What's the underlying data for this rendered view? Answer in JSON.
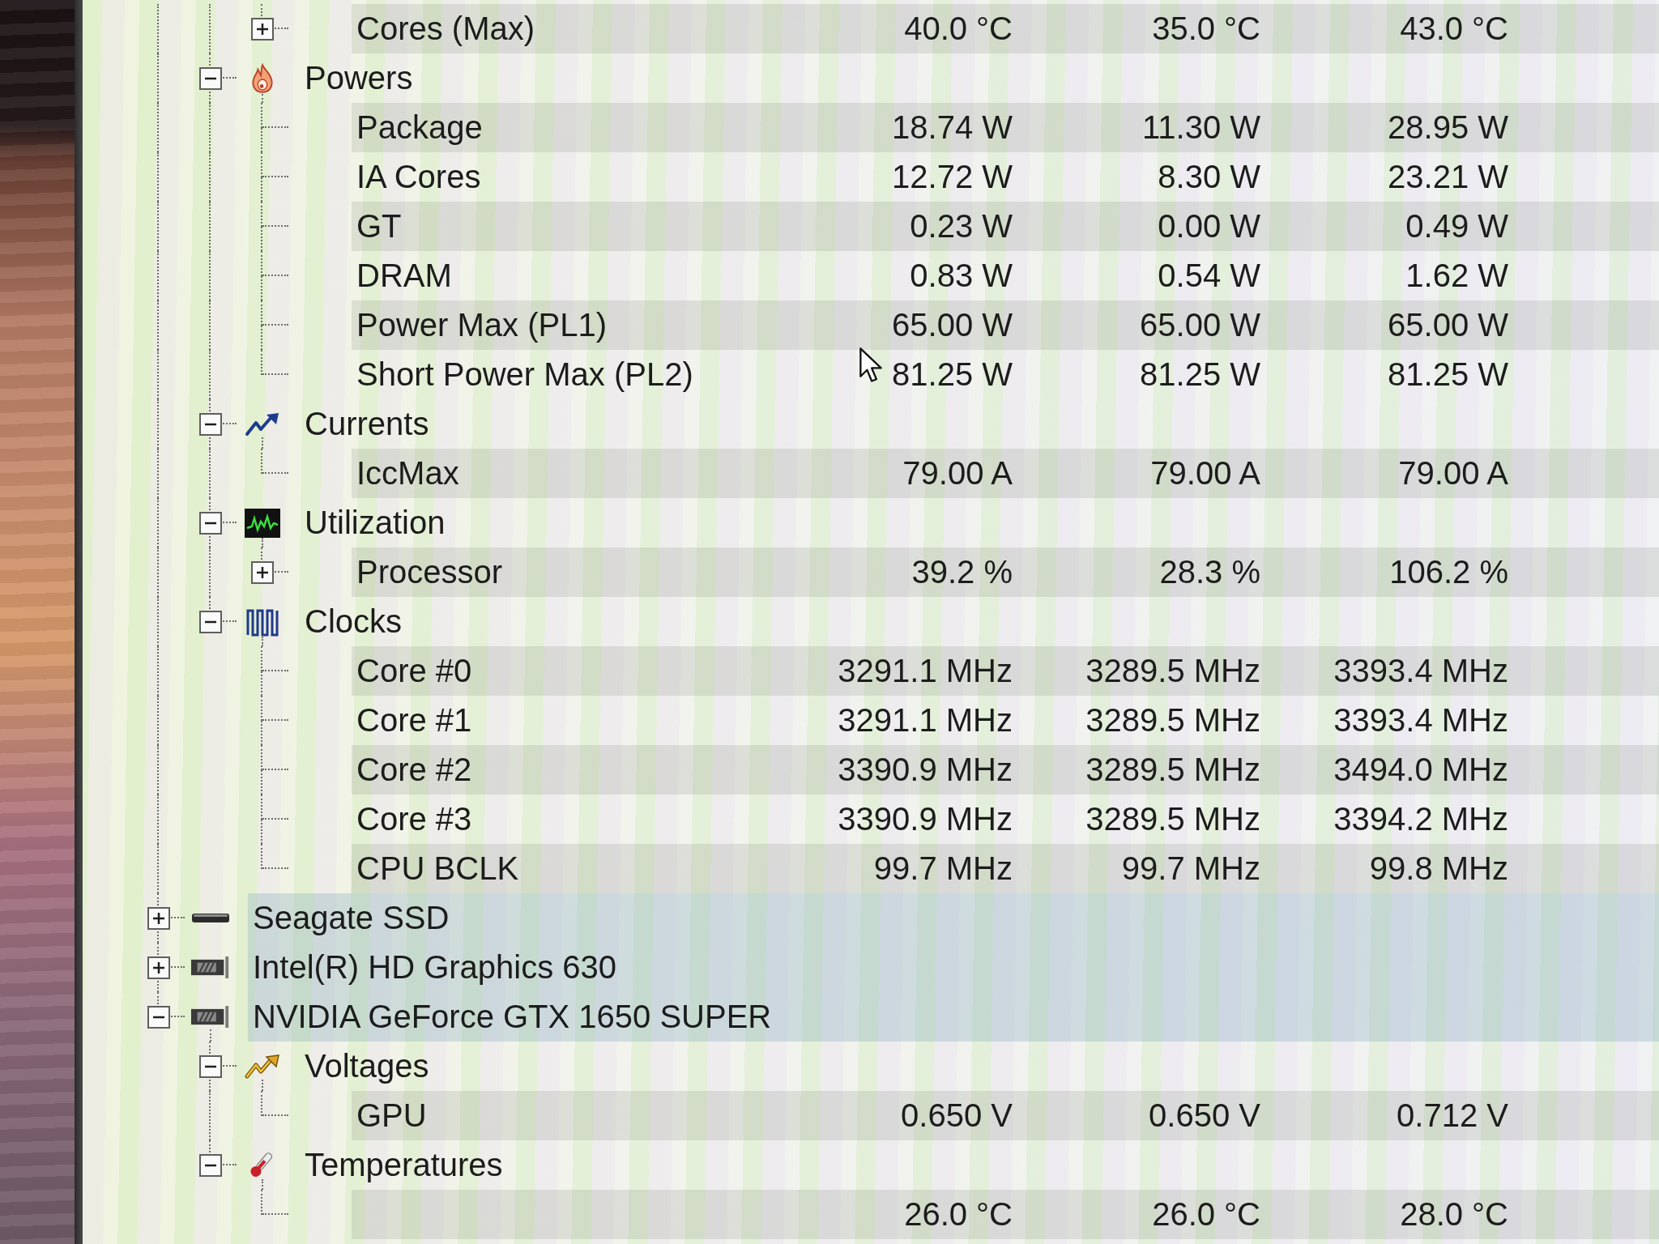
{
  "sensor_tree": [
    {
      "children": [
        {
          "children": [
            {
              "kind": "sensor",
              "label": "Cores (Max)",
              "expanded": false,
              "values": [
                "40.0 °C",
                "35.0 °C",
                "43.0 °C"
              ]
            }
          ]
        },
        {
          "kind": "power",
          "label": "Powers",
          "expanded": true,
          "children": [
            {
              "kind": "sensor",
              "label": "Package",
              "values": [
                "18.74 W",
                "11.30 W",
                "28.95 W"
              ]
            },
            {
              "kind": "sensor",
              "label": "IA Cores",
              "values": [
                "12.72 W",
                "8.30 W",
                "23.21 W"
              ]
            },
            {
              "kind": "sensor",
              "label": "GT",
              "values": [
                "0.23 W",
                "0.00 W",
                "0.49 W"
              ]
            },
            {
              "kind": "sensor",
              "label": "DRAM",
              "values": [
                "0.83 W",
                "0.54 W",
                "1.62 W"
              ]
            },
            {
              "kind": "sensor",
              "label": "Power Max (PL1)",
              "values": [
                "65.00 W",
                "65.00 W",
                "65.00 W"
              ]
            },
            {
              "kind": "sensor",
              "label": "Short Power Max (PL2)",
              "values": [
                "81.25 W",
                "81.25 W",
                "81.25 W"
              ]
            }
          ]
        },
        {
          "kind": "current",
          "label": "Currents",
          "expanded": true,
          "children": [
            {
              "kind": "sensor",
              "label": "IccMax",
              "values": [
                "79.00 A",
                "79.00 A",
                "79.00 A"
              ]
            }
          ]
        },
        {
          "kind": "utilization",
          "label": "Utilization",
          "expanded": true,
          "children": [
            {
              "kind": "sensor",
              "label": "Processor",
              "expanded": false,
              "values": [
                "39.2 %",
                "28.3 %",
                "106.2 %"
              ]
            }
          ]
        },
        {
          "kind": "clock",
          "label": "Clocks",
          "expanded": true,
          "children": [
            {
              "kind": "sensor",
              "label": "Core #0",
              "values": [
                "3291.1 MHz",
                "3289.5 MHz",
                "3393.4 MHz"
              ]
            },
            {
              "kind": "sensor",
              "label": "Core #1",
              "values": [
                "3291.1 MHz",
                "3289.5 MHz",
                "3393.4 MHz"
              ]
            },
            {
              "kind": "sensor",
              "label": "Core #2",
              "values": [
                "3390.9 MHz",
                "3289.5 MHz",
                "3494.0 MHz"
              ]
            },
            {
              "kind": "sensor",
              "label": "Core #3",
              "values": [
                "3390.9 MHz",
                "3289.5 MHz",
                "3394.2 MHz"
              ]
            },
            {
              "kind": "sensor",
              "label": "CPU BCLK",
              "values": [
                "99.7 MHz",
                "99.7 MHz",
                "99.8 MHz"
              ]
            }
          ]
        }
      ]
    },
    {
      "kind": "drive",
      "label": "Seagate SSD",
      "expanded": false
    },
    {
      "kind": "graphics",
      "label": "Intel(R) HD Graphics 630",
      "expanded": false
    },
    {
      "kind": "graphics",
      "label": "NVIDIA GeForce GTX 1650 SUPER",
      "expanded": true,
      "children": [
        {
          "kind": "voltage",
          "label": "Voltages",
          "expanded": true,
          "children": [
            {
              "kind": "sensor",
              "label": "GPU",
              "values": [
                "0.650 V",
                "0.650 V",
                "0.712 V"
              ]
            }
          ]
        },
        {
          "kind": "temperature",
          "label": "Temperatures",
          "expanded": true,
          "children": [
            {
              "kind": "sensor",
              "values": [
                "26.0 °C",
                "26.0 °C",
                "28.0 °C"
              ]
            }
          ]
        }
      ]
    }
  ]
}
